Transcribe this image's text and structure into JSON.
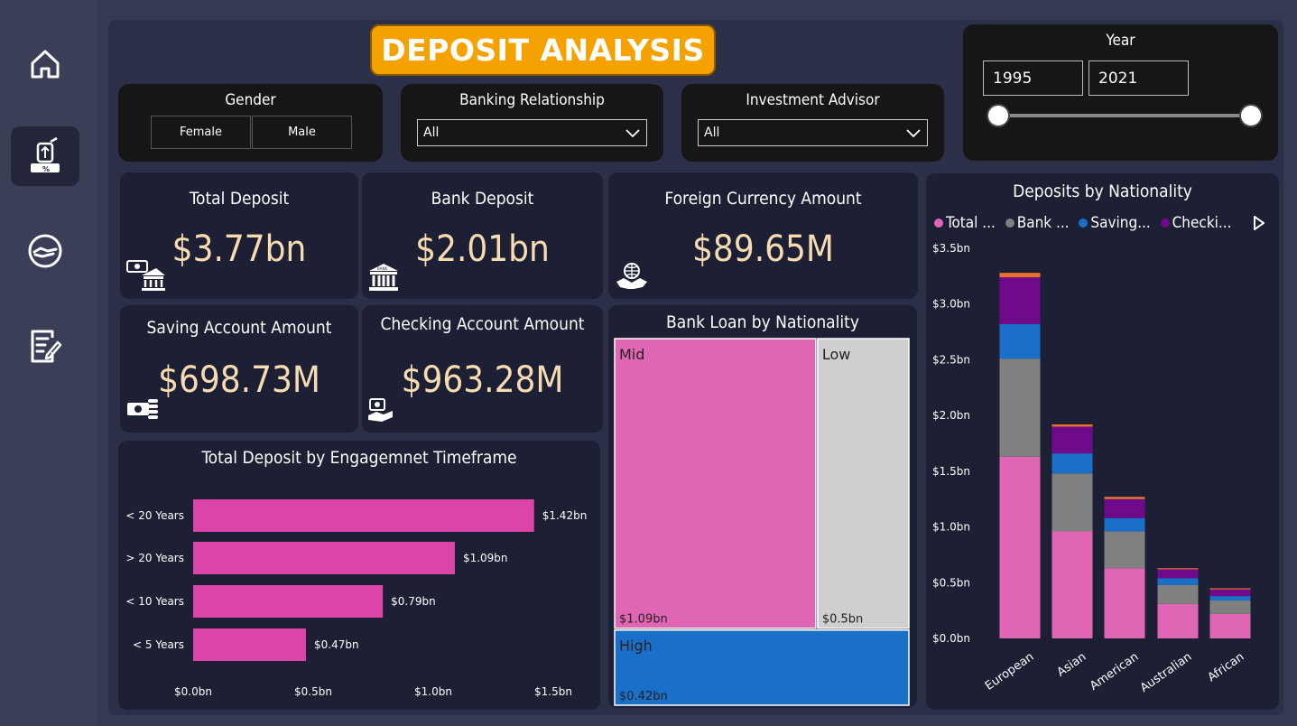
{
  "title": "DEPOSIT ANALYSIS",
  "nav": {
    "items": [
      {
        "icon": "home-icon"
      },
      {
        "icon": "deposit-icon"
      },
      {
        "icon": "loan-icon"
      },
      {
        "icon": "report-icon"
      }
    ]
  },
  "filters": {
    "gender": {
      "title": "Gender",
      "options": [
        "Female",
        "Male"
      ]
    },
    "banking_relationship": {
      "title": "Banking Relationship",
      "value": "All"
    },
    "investment_advisor": {
      "title": "Investment Advisor",
      "value": "All"
    },
    "year": {
      "title": "Year",
      "start": "1995",
      "end": "2021"
    }
  },
  "kpis": {
    "total_deposit": {
      "title": "Total Deposit",
      "value": "$3.77bn"
    },
    "bank_deposit": {
      "title": "Bank Deposit",
      "value": "$2.01bn"
    },
    "foreign_currency": {
      "title": "Foreign Currency Amount",
      "value": "$89.65M"
    },
    "saving_account": {
      "title": "Saving Account Amount",
      "value": "$698.73M"
    },
    "checking_account": {
      "title": "Checking Account Amount",
      "value": "$963.28M"
    }
  },
  "colors": {
    "pink": "#e066b5",
    "magenta": "#dd44a8",
    "gray": "#808080",
    "blue": "#1a6fc9",
    "purple": "#6f0a8a",
    "orange": "#e8732e",
    "light_gray": "#cfcfcf",
    "kpi_value": "#f6dcb0",
    "title_bg": "#f5a200"
  },
  "chart_data": [
    {
      "type": "bar",
      "orientation": "horizontal",
      "title": "Total Deposit by Engagemnet Timeframe",
      "categories": [
        "< 20 Years",
        "> 20 Years",
        "< 10 Years",
        "< 5 Years"
      ],
      "values": [
        1.42,
        1.09,
        0.79,
        0.47
      ],
      "value_labels": [
        "$1.42bn",
        "$1.09bn",
        "$0.79bn",
        "$0.47bn"
      ],
      "xticks": [
        "$0.0bn",
        "$0.5bn",
        "$1.0bn",
        "$1.5bn"
      ],
      "xlim": [
        0,
        1.5
      ]
    },
    {
      "type": "treemap",
      "title": "Bank Loan by Nationality",
      "items": [
        {
          "label": "Mid",
          "value": 1.09,
          "value_label": "$1.09bn"
        },
        {
          "label": "Low",
          "value": 0.5,
          "value_label": "$0.5bn"
        },
        {
          "label": "High",
          "value": 0.42,
          "value_label": "$0.42bn"
        }
      ]
    },
    {
      "type": "bar",
      "stacked": true,
      "title": "Deposits by Nationality",
      "categories": [
        "European",
        "Asian",
        "American",
        "Australian",
        "African"
      ],
      "legend": [
        "Total ...",
        "Bank ...",
        "Saving...",
        "Checki..."
      ],
      "yticks": [
        "$0.0bn",
        "$0.5bn",
        "$1.0bn",
        "$1.5bn",
        "$2.0bn",
        "$2.5bn",
        "$3.0bn",
        "$3.5bn"
      ],
      "ylim": [
        0,
        3.5
      ],
      "series": [
        {
          "name": "Total ...",
          "values": [
            1.63,
            0.96,
            0.63,
            0.31,
            0.22
          ]
        },
        {
          "name": "Bank ...",
          "values": [
            0.88,
            0.52,
            0.33,
            0.17,
            0.12
          ]
        },
        {
          "name": "Saving...",
          "values": [
            0.31,
            0.18,
            0.12,
            0.06,
            0.04
          ]
        },
        {
          "name": "Checki...",
          "values": [
            0.42,
            0.24,
            0.17,
            0.08,
            0.06
          ]
        },
        {
          "values": [
            0.04,
            0.02,
            0.02,
            0.01,
            0.01
          ]
        }
      ]
    }
  ]
}
